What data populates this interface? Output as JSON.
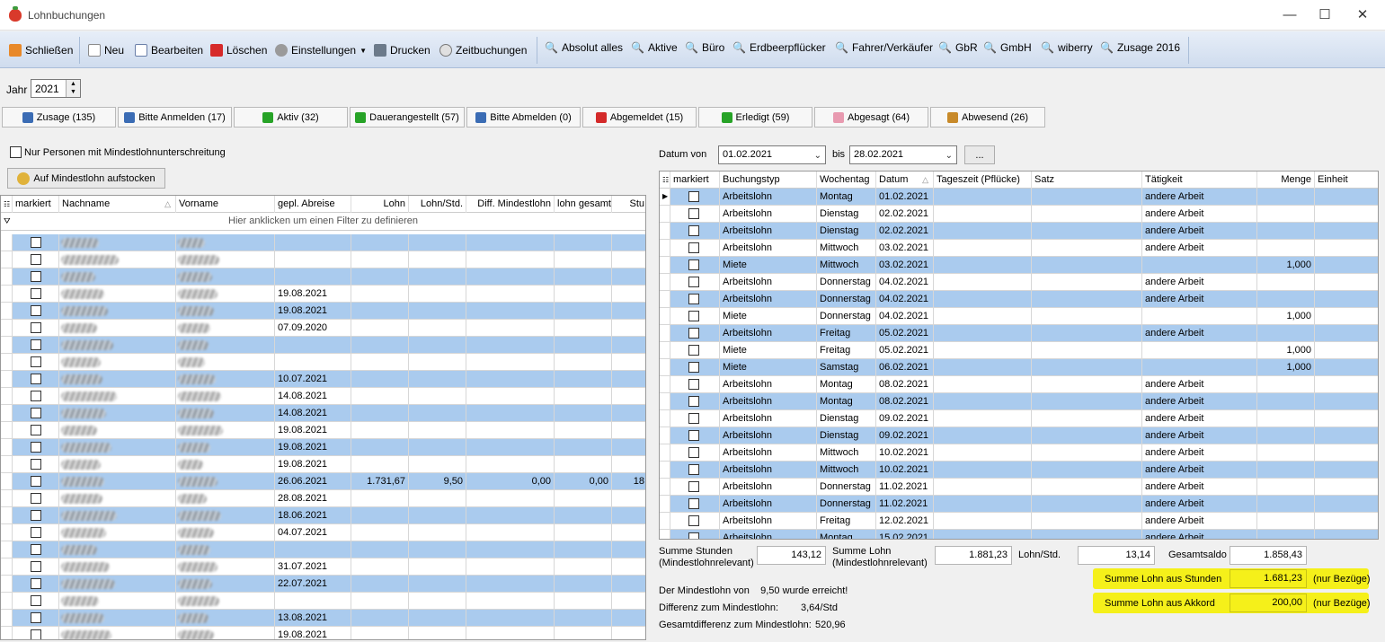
{
  "window": {
    "title": "Lohnbuchungen",
    "minimize": "—",
    "maximize": "☐",
    "close": "✕"
  },
  "toolbar": {
    "close": "Schließen",
    "new": "Neu",
    "edit": "Bearbeiten",
    "delete": "Löschen",
    "settings": "Einstellungen",
    "print": "Drucken",
    "time": "Zeitbuchungen",
    "filters": [
      "Absolut alles",
      "Aktive",
      "Büro",
      "Erdbeerpflücker",
      "Fahrer/Verkäufer",
      "GbR",
      "GmbH",
      "wiberry",
      "Zusage 2016"
    ]
  },
  "year": {
    "label": "Jahr",
    "value": "2021"
  },
  "status_tabs": [
    {
      "label": "Zusage (135)",
      "color": "#3b6cb4"
    },
    {
      "label": "Bitte Anmelden (17)",
      "color": "#3b6cb4"
    },
    {
      "label": "Aktiv (32)",
      "color": "#27a327"
    },
    {
      "label": "Dauerangestellt (57)",
      "color": "#27a327"
    },
    {
      "label": "Bitte Abmelden (0)",
      "color": "#3b6cb4"
    },
    {
      "label": "Abgemeldet (15)",
      "color": "#d42a2a"
    },
    {
      "label": "Erledigt (59)",
      "color": "#27a327"
    },
    {
      "label": "Abgesagt (64)",
      "color": "#e89ab0"
    },
    {
      "label": "Abwesend (26)",
      "color": "#c88a2a"
    }
  ],
  "left": {
    "min_check_label": "Nur Personen mit Mindestlohnunterschreitung",
    "topup_button": "Auf Mindestlohn aufstocken",
    "filter_hint": "Hier anklicken um einen Filter zu definieren",
    "columns": [
      "markiert",
      "Nachname",
      "Vorname",
      "gepl. Abreise",
      "Lohn",
      "Lohn/Std.",
      "Diff. Mindestlohn",
      "lohn gesamt",
      "Stu"
    ],
    "rows": [
      {
        "abreise": "",
        "lohn": "",
        "lohnstd": "",
        "diff": "",
        "gesamt": "",
        "stu": ""
      },
      {
        "abreise": "",
        "lohn": "",
        "lohnstd": "",
        "diff": "",
        "gesamt": "",
        "stu": ""
      },
      {
        "abreise": "",
        "lohn": "",
        "lohnstd": "",
        "diff": "",
        "gesamt": "",
        "stu": ""
      },
      {
        "abreise": "19.08.2021",
        "lohn": "",
        "lohnstd": "",
        "diff": "",
        "gesamt": "",
        "stu": ""
      },
      {
        "abreise": "19.08.2021",
        "lohn": "",
        "lohnstd": "",
        "diff": "",
        "gesamt": "",
        "stu": ""
      },
      {
        "abreise": "07.09.2020",
        "lohn": "",
        "lohnstd": "",
        "diff": "",
        "gesamt": "",
        "stu": ""
      },
      {
        "abreise": "",
        "lohn": "",
        "lohnstd": "",
        "diff": "",
        "gesamt": "",
        "stu": ""
      },
      {
        "abreise": "",
        "lohn": "",
        "lohnstd": "",
        "diff": "",
        "gesamt": "",
        "stu": ""
      },
      {
        "abreise": "10.07.2021",
        "lohn": "",
        "lohnstd": "",
        "diff": "",
        "gesamt": "",
        "stu": ""
      },
      {
        "abreise": "14.08.2021",
        "lohn": "",
        "lohnstd": "",
        "diff": "",
        "gesamt": "",
        "stu": ""
      },
      {
        "abreise": "14.08.2021",
        "lohn": "",
        "lohnstd": "",
        "diff": "",
        "gesamt": "",
        "stu": ""
      },
      {
        "abreise": "19.08.2021",
        "lohn": "",
        "lohnstd": "",
        "diff": "",
        "gesamt": "",
        "stu": ""
      },
      {
        "abreise": "19.08.2021",
        "lohn": "",
        "lohnstd": "",
        "diff": "",
        "gesamt": "",
        "stu": ""
      },
      {
        "abreise": "19.08.2021",
        "lohn": "",
        "lohnstd": "",
        "diff": "",
        "gesamt": "",
        "stu": ""
      },
      {
        "abreise": "26.06.2021",
        "lohn": "1.731,67",
        "lohnstd": "9,50",
        "diff": "0,00",
        "gesamt": "0,00",
        "stu": "18"
      },
      {
        "abreise": "28.08.2021",
        "lohn": "",
        "lohnstd": "",
        "diff": "",
        "gesamt": "",
        "stu": ""
      },
      {
        "abreise": "18.06.2021",
        "lohn": "",
        "lohnstd": "",
        "diff": "",
        "gesamt": "",
        "stu": ""
      },
      {
        "abreise": "04.07.2021",
        "lohn": "",
        "lohnstd": "",
        "diff": "",
        "gesamt": "",
        "stu": ""
      },
      {
        "abreise": "",
        "lohn": "",
        "lohnstd": "",
        "diff": "",
        "gesamt": "",
        "stu": ""
      },
      {
        "abreise": "31.07.2021",
        "lohn": "",
        "lohnstd": "",
        "diff": "",
        "gesamt": "",
        "stu": ""
      },
      {
        "abreise": "22.07.2021",
        "lohn": "",
        "lohnstd": "",
        "diff": "",
        "gesamt": "",
        "stu": ""
      },
      {
        "abreise": "",
        "lohn": "",
        "lohnstd": "",
        "diff": "",
        "gesamt": "",
        "stu": ""
      },
      {
        "abreise": "13.08.2021",
        "lohn": "",
        "lohnstd": "",
        "diff": "",
        "gesamt": "",
        "stu": ""
      },
      {
        "abreise": "19.08.2021",
        "lohn": "",
        "lohnstd": "",
        "diff": "",
        "gesamt": "",
        "stu": ""
      }
    ]
  },
  "right": {
    "date_from_label": "Datum von",
    "date_from": "01.02.2021",
    "date_to_label": "bis",
    "date_to": "28.02.2021",
    "more_button": "...",
    "columns": [
      "markiert",
      "Buchungstyp",
      "Wochentag",
      "Datum",
      "Tageszeit (Pflücke)",
      "Satz",
      "Tätigkeit",
      "Menge",
      "Einheit"
    ],
    "rows": [
      {
        "typ": "Arbeitslohn",
        "tag": "Montag",
        "datum": "01.02.2021",
        "taet": "andere Arbeit",
        "menge": ""
      },
      {
        "typ": "Arbeitslohn",
        "tag": "Dienstag",
        "datum": "02.02.2021",
        "taet": "andere Arbeit",
        "menge": ""
      },
      {
        "typ": "Arbeitslohn",
        "tag": "Dienstag",
        "datum": "02.02.2021",
        "taet": "andere Arbeit",
        "menge": ""
      },
      {
        "typ": "Arbeitslohn",
        "tag": "Mittwoch",
        "datum": "03.02.2021",
        "taet": "andere Arbeit",
        "menge": ""
      },
      {
        "typ": "Miete",
        "tag": "Mittwoch",
        "datum": "03.02.2021",
        "taet": "",
        "menge": "1,000"
      },
      {
        "typ": "Arbeitslohn",
        "tag": "Donnerstag",
        "datum": "04.02.2021",
        "taet": "andere Arbeit",
        "menge": ""
      },
      {
        "typ": "Arbeitslohn",
        "tag": "Donnerstag",
        "datum": "04.02.2021",
        "taet": "andere Arbeit",
        "menge": ""
      },
      {
        "typ": "Miete",
        "tag": "Donnerstag",
        "datum": "04.02.2021",
        "taet": "",
        "menge": "1,000"
      },
      {
        "typ": "Arbeitslohn",
        "tag": "Freitag",
        "datum": "05.02.2021",
        "taet": "andere Arbeit",
        "menge": ""
      },
      {
        "typ": "Miete",
        "tag": "Freitag",
        "datum": "05.02.2021",
        "taet": "",
        "menge": "1,000"
      },
      {
        "typ": "Miete",
        "tag": "Samstag",
        "datum": "06.02.2021",
        "taet": "",
        "menge": "1,000"
      },
      {
        "typ": "Arbeitslohn",
        "tag": "Montag",
        "datum": "08.02.2021",
        "taet": "andere Arbeit",
        "menge": ""
      },
      {
        "typ": "Arbeitslohn",
        "tag": "Montag",
        "datum": "08.02.2021",
        "taet": "andere Arbeit",
        "menge": ""
      },
      {
        "typ": "Arbeitslohn",
        "tag": "Dienstag",
        "datum": "09.02.2021",
        "taet": "andere Arbeit",
        "menge": ""
      },
      {
        "typ": "Arbeitslohn",
        "tag": "Dienstag",
        "datum": "09.02.2021",
        "taet": "andere Arbeit",
        "menge": ""
      },
      {
        "typ": "Arbeitslohn",
        "tag": "Mittwoch",
        "datum": "10.02.2021",
        "taet": "andere Arbeit",
        "menge": ""
      },
      {
        "typ": "Arbeitslohn",
        "tag": "Mittwoch",
        "datum": "10.02.2021",
        "taet": "andere Arbeit",
        "menge": ""
      },
      {
        "typ": "Arbeitslohn",
        "tag": "Donnerstag",
        "datum": "11.02.2021",
        "taet": "andere Arbeit",
        "menge": ""
      },
      {
        "typ": "Arbeitslohn",
        "tag": "Donnerstag",
        "datum": "11.02.2021",
        "taet": "andere Arbeit",
        "menge": ""
      },
      {
        "typ": "Arbeitslohn",
        "tag": "Freitag",
        "datum": "12.02.2021",
        "taet": "andere Arbeit",
        "menge": ""
      },
      {
        "typ": "Arbeitslohn",
        "tag": "Montag",
        "datum": "15.02.2021",
        "taet": "andere Arbeit",
        "menge": ""
      }
    ]
  },
  "summary": {
    "stunden_label": "Summe Stunden",
    "stunden_sub": "(Mindestlohnrelevant)",
    "stunden": "143,12",
    "lohn_label": "Summe Lohn",
    "lohn_sub": "(Mindestlohnrelevant)",
    "lohn": "1.881,23",
    "lohnstd_label": "Lohn/Std.",
    "lohnstd": "13,14",
    "saldo_label": "Gesamtsaldo",
    "saldo": "1.858,43",
    "aus_stunden_label": "Summe Lohn aus Stunden",
    "aus_stunden": "1.681,23",
    "aus_akkord_label": "Summe Lohn aus Akkord",
    "aus_akkord": "200,00",
    "nur_bezuege": "(nur Bezüge)",
    "min_reached": "Der Mindestlohn von    9,50 wurde erreicht!",
    "diff_label": "Differenz zum Mindestlohn:",
    "diff": "3,64/Std",
    "gesamtdiff_label": "Gesamtdifferenz zum Mindestlohn:",
    "gesamtdiff": "520,96"
  }
}
